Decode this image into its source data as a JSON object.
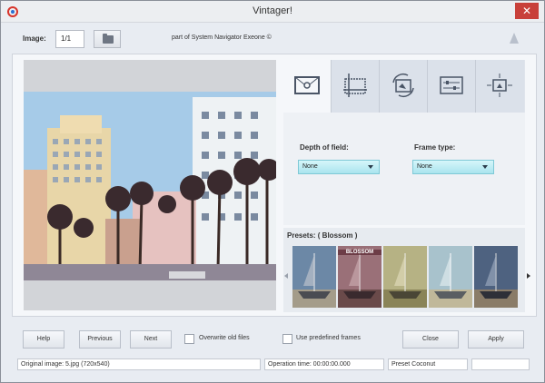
{
  "window": {
    "title": "Vintager!",
    "close_glyph": "✕"
  },
  "toolbar": {
    "image_label": "Image:",
    "image_value": "1/1",
    "browse_icon": "folder-icon",
    "subtitle": "part of System Navigator Exeone ©"
  },
  "tabs": [
    {
      "icon": "frame-icon",
      "active": true
    },
    {
      "icon": "crop-icon",
      "active": false
    },
    {
      "icon": "rotate-image-icon",
      "active": false
    },
    {
      "icon": "adjust-icon",
      "active": false
    },
    {
      "icon": "resize-icon",
      "active": false
    }
  ],
  "options": {
    "depth_label": "Depth of field:",
    "depth_value": "None",
    "frame_label": "Frame type:",
    "frame_value": "None"
  },
  "presets": {
    "label": "Presets: ( Blossom )",
    "selected_label": "BLOSSOM",
    "thumbs": [
      {
        "tint": "#7c92a8",
        "selected": false
      },
      {
        "tint": "#8a5a62",
        "selected": true
      },
      {
        "tint": "#a8a070",
        "selected": false
      },
      {
        "tint": "#9ab0b8",
        "selected": false
      },
      {
        "tint": "#5c6c84",
        "selected": false
      }
    ]
  },
  "buttons": {
    "help": "Help",
    "previous": "Previous",
    "next": "Next",
    "overwrite": "Overwrite old files",
    "predefined": "Use predefined frames",
    "close": "Close",
    "apply": "Apply"
  },
  "status": {
    "original": "Original image: 5.jpg (720x540)",
    "operation": "Operation time: 00:00:00.000",
    "preset": "Preset Coconut",
    "extra": ""
  },
  "colors": {
    "accent_select": "#a9e4ee",
    "close_red": "#c8403a"
  }
}
